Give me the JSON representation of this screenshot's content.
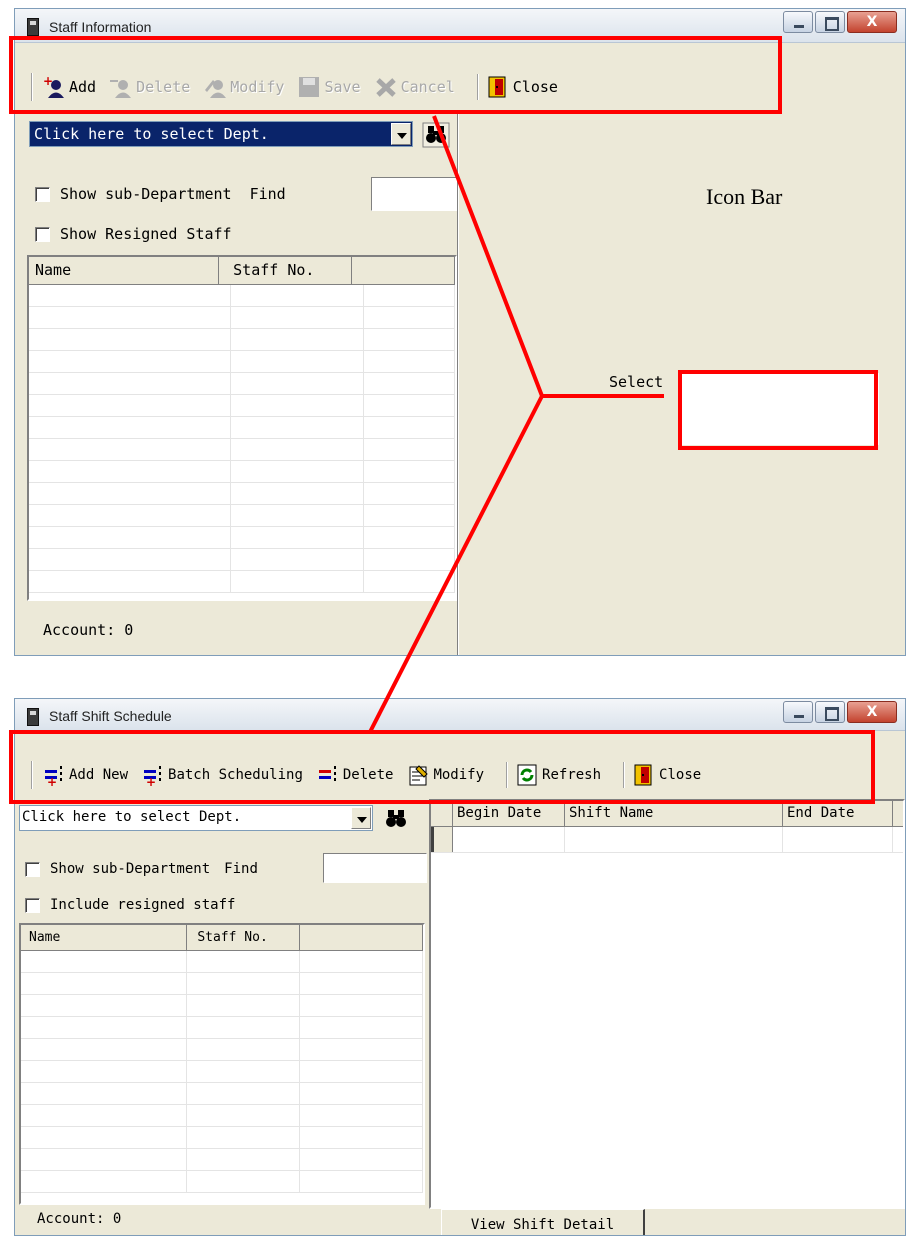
{
  "win1": {
    "title": "Staff Information",
    "toolbar": {
      "add": "Add",
      "delete": "Delete",
      "modify": "Modify",
      "save": "Save",
      "cancel": "Cancel",
      "close": "Close"
    },
    "dept_combo": "Click here to select Dept.",
    "show_sub_dept": "Show sub-Department",
    "find_label": "Find",
    "show_resigned": "Show Resigned Staff",
    "columns": [
      "Name",
      "Staff No.",
      ""
    ],
    "account": "Account: 0",
    "select_text": "Select"
  },
  "win2": {
    "title": "Staff Shift Schedule",
    "toolbar": {
      "add_new": "Add New",
      "batch": "Batch Scheduling",
      "delete": "Delete",
      "modify": "Modify",
      "refresh": "Refresh",
      "close": "Close"
    },
    "dept_combo": "Click here to select Dept.",
    "show_sub_dept": "Show sub-Department",
    "find_label": "Find",
    "include_resigned": "Include resigned staff",
    "columns": [
      "Name",
      "Staff No.",
      ""
    ],
    "schedule_columns": [
      "Begin Date",
      "Shift Name",
      "End Date"
    ],
    "account": "Account: 0",
    "view_detail": "View Shift Detail"
  },
  "annotations": {
    "icon_bar": "Icon Bar"
  },
  "colors": {
    "highlight": "#0a246a",
    "annotation_red": "#ff0000",
    "window_face": "#ece9d8"
  }
}
